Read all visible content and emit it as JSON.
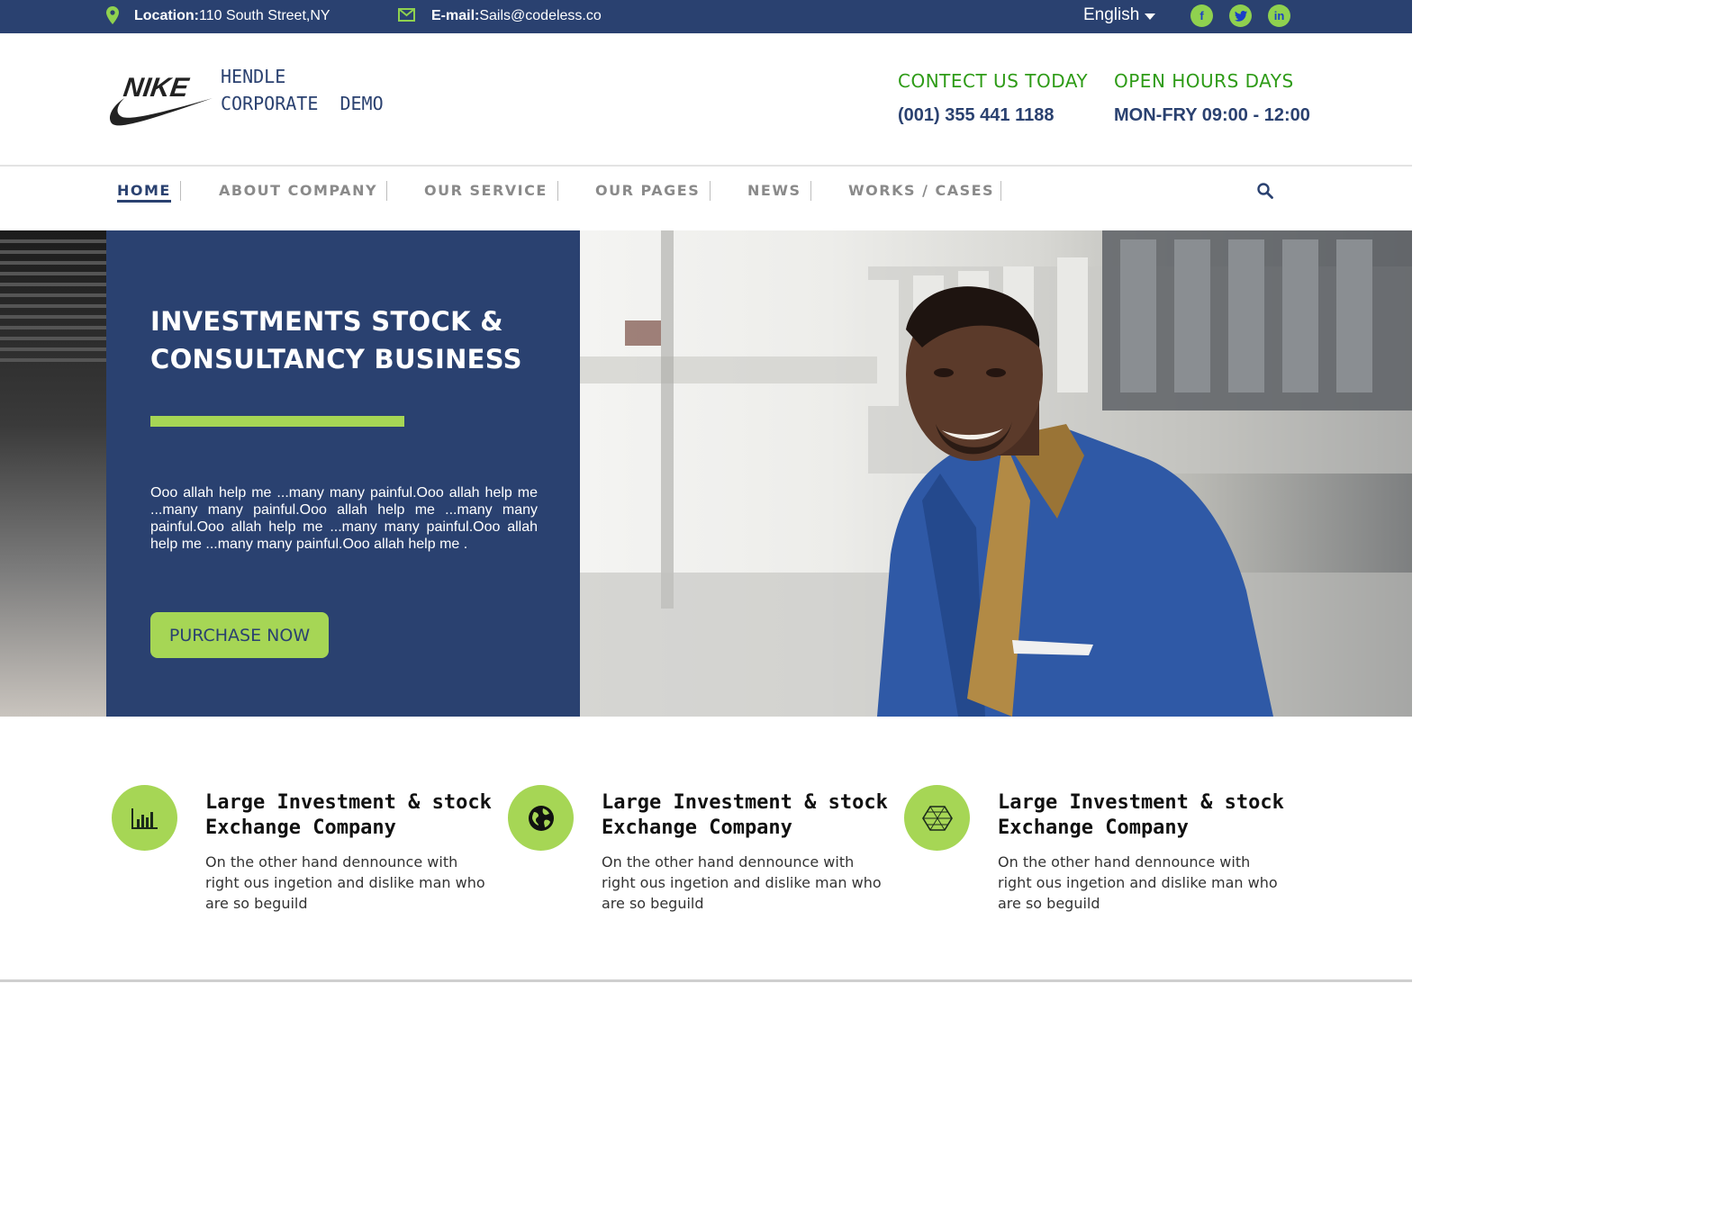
{
  "topbar": {
    "location_label": "Location:",
    "location_value": "110 South Street,NY",
    "email_label": "E-mail:",
    "email_value": "Sails@codeless.co",
    "language": "English",
    "social": {
      "facebook": "f",
      "twitter": "t",
      "linkedin": "in"
    },
    "icons": [
      "location-pin-icon",
      "envelope-icon",
      "chevron-down-icon",
      "facebook-icon",
      "twitter-icon",
      "linkedin-icon"
    ]
  },
  "header": {
    "logo_text": "NIKE",
    "brand_line1": "HENDLE",
    "brand_line2": "CORPORATE  DEMO",
    "contact_label": "CONTECT US TODAY",
    "contact_value": "(001) 355 441 1188",
    "hours_label": "OPEN HOURS DAYS",
    "hours_value": "MON-FRY 09:00 - 12:00"
  },
  "nav": {
    "items": [
      {
        "label": "HOME",
        "active": true
      },
      {
        "label": "ABOUT COMPANY",
        "active": false
      },
      {
        "label": "OUR SERVICE",
        "active": false
      },
      {
        "label": "OUR PAGES",
        "active": false
      },
      {
        "label": "NEWS",
        "active": false
      },
      {
        "label": "WORKS / CASES",
        "active": false
      }
    ],
    "search_icon": "search-icon"
  },
  "hero": {
    "title": "INVESTMENTS STOCK & CONSULTANCY BUSINESS",
    "text": "Ooo allah help me ...many many painful.Ooo allah help me ...many many painful.Ooo allah help me ...many many painful.Ooo allah help me ...many many painful.Ooo allah help me ...many many painful.Ooo allah help me .",
    "button": "PURCHASE NOW"
  },
  "features": [
    {
      "icon": "bar-chart-icon",
      "title": "Large Investment & stock Exchange Company",
      "text": "On the other hand dennounce with right ous ingetion and dislike man who are so beguild"
    },
    {
      "icon": "globe-icon",
      "title": "Large Investment & stock Exchange Company",
      "text": "On the other hand dennounce with right ous ingetion and dislike man who are so beguild"
    },
    {
      "icon": "hexagon-net-icon",
      "title": "Large Investment & stock Exchange Company",
      "text": "On the other hand dennounce with right ous ingetion and dislike man who are so beguild"
    }
  ],
  "colors": {
    "navy": "#2a4170",
    "lime": "#a6d655",
    "green_text": "#2e9b17",
    "nav_grey": "#8a8a8a"
  }
}
